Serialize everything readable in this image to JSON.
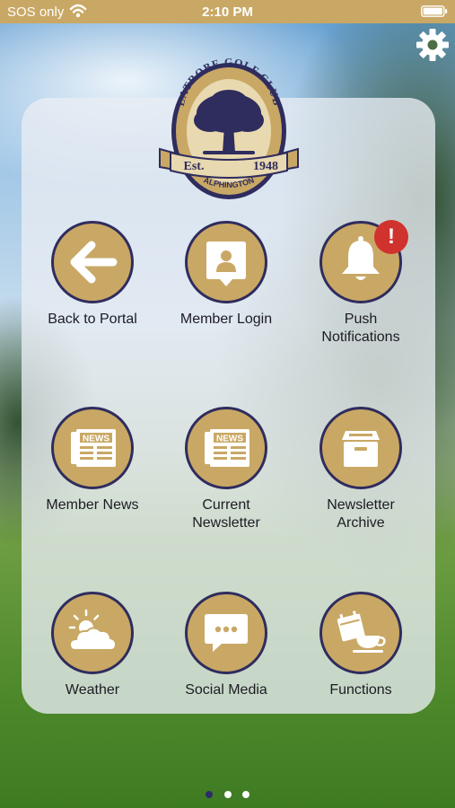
{
  "status_bar": {
    "carrier": "SOS only",
    "time": "2:10 PM"
  },
  "header": {
    "settings_icon": "gear-icon"
  },
  "logo": {
    "name": "LATROBE GOLF CLUB",
    "est": "Est.",
    "year": "1948",
    "location": "ALPHINGTON"
  },
  "tiles": [
    {
      "label": "Back to Portal",
      "icon": "arrow-left-icon"
    },
    {
      "label": "Member Login",
      "icon": "member-badge-icon"
    },
    {
      "label": "Push\nNotifications",
      "icon": "bell-icon",
      "badge": "!"
    },
    {
      "label": "Member News",
      "icon": "newspaper-icon",
      "icon_text": "NEWS"
    },
    {
      "label": "Current\nNewsletter",
      "icon": "newspaper-icon",
      "icon_text": "NEWS"
    },
    {
      "label": "Newsletter\nArchive",
      "icon": "archive-box-icon"
    },
    {
      "label": "Weather",
      "icon": "weather-icon"
    },
    {
      "label": "Social Media",
      "icon": "chat-bubble-icon"
    },
    {
      "label": "Functions",
      "icon": "calendar-cup-icon"
    }
  ],
  "colors": {
    "gold": "#c9a865",
    "navy": "#2f2c5e",
    "badge_red": "#d0322e"
  },
  "pager": {
    "pages": 3,
    "current": 1
  }
}
